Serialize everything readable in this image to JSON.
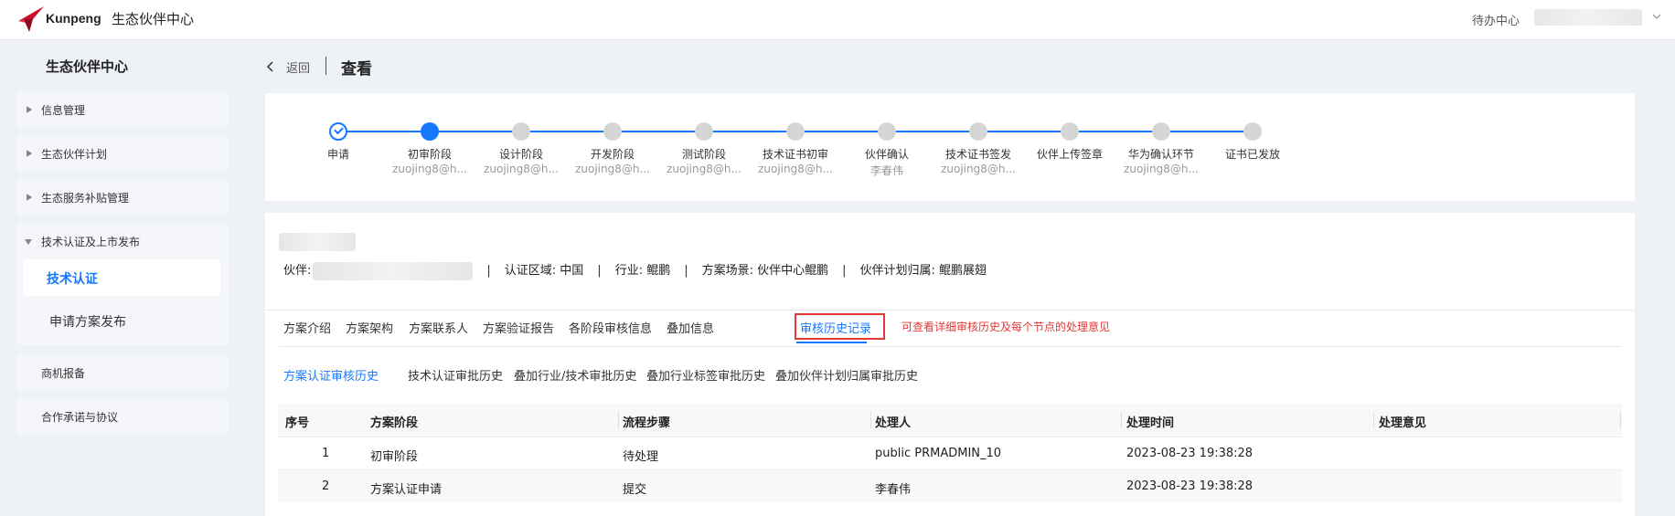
{
  "topbar": {
    "brand": "Kunpeng",
    "app_title": "生态伙伴中心",
    "todo_label": "待办中心",
    "logo_color": "#c8102e"
  },
  "sidebar": {
    "title": "生态伙伴中心",
    "items": [
      {
        "label": "信息管理"
      },
      {
        "label": "生态伙伴计划"
      },
      {
        "label": "生态服务补贴管理"
      }
    ],
    "group": {
      "label": "技术认证及上市发布",
      "children": [
        {
          "label": "技术认证",
          "active": true
        },
        {
          "label": "申请方案发布",
          "active": false
        }
      ]
    },
    "bottom_items": [
      {
        "label": "商机报备"
      },
      {
        "label": "合作承诺与协议"
      }
    ]
  },
  "header": {
    "back_label": "返回",
    "title": "查看"
  },
  "steps": [
    {
      "name": "申请",
      "sub": "",
      "state": "done"
    },
    {
      "name": "初审阶段",
      "sub": "zuojing8@h...",
      "state": "current"
    },
    {
      "name": "设计阶段",
      "sub": "zuojing8@h...",
      "state": "pending"
    },
    {
      "name": "开发阶段",
      "sub": "zuojing8@h...",
      "state": "pending"
    },
    {
      "name": "测试阶段",
      "sub": "zuojing8@h...",
      "state": "pending"
    },
    {
      "name": "技术证书初审",
      "sub": "zuojing8@h...",
      "state": "pending"
    },
    {
      "name": "伙伴确认",
      "sub": "李春伟",
      "state": "pending"
    },
    {
      "name": "技术证书签发",
      "sub": "zuojing8@h...",
      "state": "pending"
    },
    {
      "name": "伙伴上传签章",
      "sub": "",
      "state": "pending"
    },
    {
      "name": "华为确认环节",
      "sub": "zuojing8@h...",
      "state": "pending"
    },
    {
      "name": "证书已发放",
      "sub": "",
      "state": "pending"
    }
  ],
  "info": {
    "partner_label": "伙伴:",
    "region": "认证区域: 中国",
    "industry": "行业: 鲲鹏",
    "scenario": "方案场景: 伙伴中心鲲鹏",
    "plan": "伙伴计划归属: 鲲鹏展翅",
    "separator": "|"
  },
  "tabs": [
    {
      "label": "方案介绍"
    },
    {
      "label": "方案架构"
    },
    {
      "label": "方案联系人"
    },
    {
      "label": "方案验证报告"
    },
    {
      "label": "各阶段审核信息"
    },
    {
      "label": "叠加信息"
    },
    {
      "label": "审核历史记录",
      "active": true
    }
  ],
  "annotation": "可查看详细审核历史及每个节点的处理意见",
  "subtabs": [
    {
      "label": "方案认证审核历史",
      "active": true
    },
    {
      "label": "技术认证审批历史"
    },
    {
      "label": "叠加行业/技术审批历史"
    },
    {
      "label": "叠加行业标签审批历史"
    },
    {
      "label": "叠加伙伴计划归属审批历史"
    }
  ],
  "table": {
    "columns": [
      "序号",
      "方案阶段",
      "流程步骤",
      "处理人",
      "处理时间",
      "处理意见"
    ],
    "rows": [
      [
        "1",
        "初审阶段",
        "待处理",
        "public PRMADMIN_10",
        "2023-08-23 19:38:28",
        ""
      ],
      [
        "2",
        "方案认证申请",
        "提交",
        "李春伟",
        "2023-08-23 19:38:28",
        ""
      ]
    ]
  },
  "colors": {
    "primary": "#1677ff",
    "highlight": "#e53935",
    "pending": "#d6d6d6"
  }
}
